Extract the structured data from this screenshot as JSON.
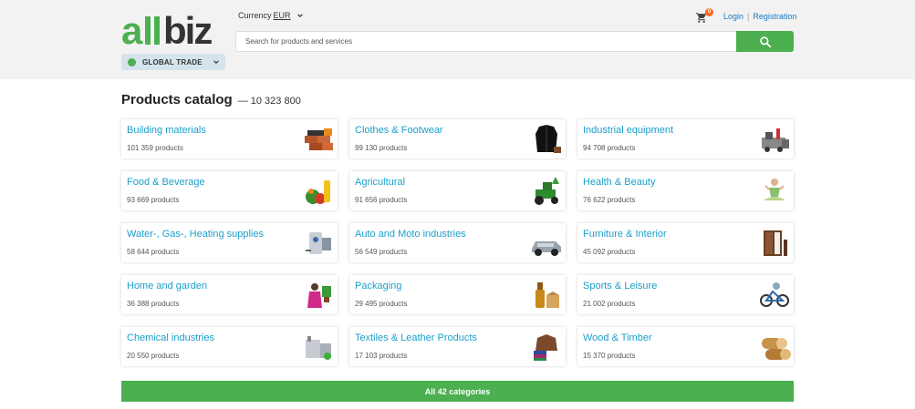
{
  "header": {
    "logo_text": "allbiz",
    "currency_label": "Currency",
    "currency_value": "EUR",
    "search_placeholder": "Search for products and services",
    "global_trade_label": "GLOBAL TRADE",
    "cart_count": "0",
    "login_label": "Login",
    "separator": "|",
    "registration_label": "Registration"
  },
  "catalog": {
    "title": "Products catalog",
    "total": "— 10 323 800",
    "categories": [
      {
        "name": "Building materials",
        "products": "101 359 products",
        "icon": "bricks-icon"
      },
      {
        "name": "Clothes & Footwear",
        "products": "99 130 products",
        "icon": "jacket-icon"
      },
      {
        "name": "Industrial equipment",
        "products": "94 708 products",
        "icon": "machinery-icon"
      },
      {
        "name": "Food & Beverage",
        "products": "93 669 products",
        "icon": "groceries-icon"
      },
      {
        "name": "Agricultural",
        "products": "91 656 products",
        "icon": "tractor-icon"
      },
      {
        "name": "Health & Beauty",
        "products": "76 622 products",
        "icon": "yoga-icon"
      },
      {
        "name": "Water-, Gas-, Heating supplies",
        "products": "58 644 products",
        "icon": "boiler-icon"
      },
      {
        "name": "Auto and Moto industries",
        "products": "56 549 products",
        "icon": "car-icon"
      },
      {
        "name": "Furniture & Interior",
        "products": "45 092 products",
        "icon": "wardrobe-icon"
      },
      {
        "name": "Home and garden",
        "products": "36 388 products",
        "icon": "gardener-icon"
      },
      {
        "name": "Packaging",
        "products": "29 495 products",
        "icon": "bottle-box-icon"
      },
      {
        "name": "Sports & Leisure",
        "products": "21 002 products",
        "icon": "bike-icon"
      },
      {
        "name": "Chemical industries",
        "products": "20 550 products",
        "icon": "chemical-tank-icon"
      },
      {
        "name": "Textiles & Leather Products",
        "products": "17 103 products",
        "icon": "textiles-icon"
      },
      {
        "name": "Wood & Timber",
        "products": "15 370 products",
        "icon": "logs-icon"
      }
    ],
    "all_button_label": "All 42 categories"
  },
  "colors": {
    "brand_green": "#4caf50",
    "link_blue": "#1a9fc9",
    "badge_orange": "#ff6a1a"
  }
}
